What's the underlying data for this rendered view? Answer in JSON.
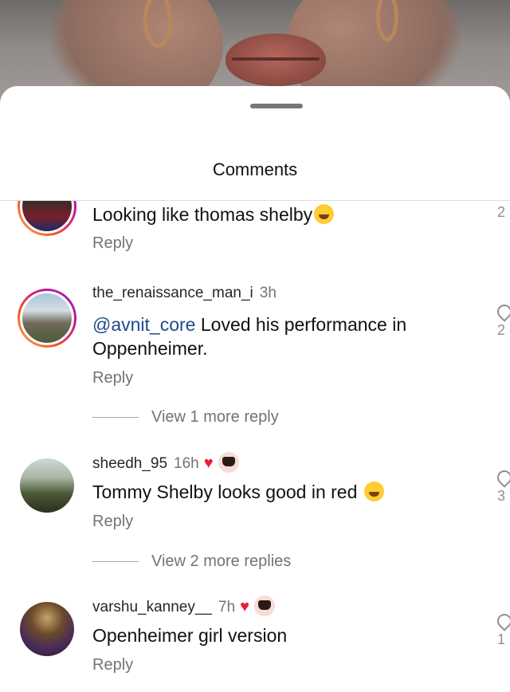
{
  "sheet": {
    "title": "Comments"
  },
  "comments": [
    {
      "text": "Looking like thomas shelby",
      "emoji": "tears-of-joy-emoji",
      "reply_label": "Reply",
      "like_count": "2"
    },
    {
      "username": "the_renaissance_man_i",
      "time": "3h",
      "mention": "@avnit_core",
      "text": " Loved his performance in Oppenheimer.",
      "reply_label": "Reply",
      "view_more": "View 1 more reply",
      "like_count": "2"
    },
    {
      "username": "sheedh_95",
      "time": "16h",
      "text": "Tommy Shelby looks good in red ",
      "emoji": "grinning-squinting-emoji",
      "reply_label": "Reply",
      "view_more": "View 2 more replies",
      "like_count": "3"
    },
    {
      "username": "varshu_kanney__",
      "time": "7h",
      "text": "Openheimer girl version",
      "reply_label": "Reply",
      "like_count": "1"
    }
  ],
  "icons": {
    "heart": "heart-icon",
    "like": "heart-outline-icon"
  },
  "colors": {
    "heart": "#ed1c3a",
    "mention": "#1f4a8a",
    "secondary_text": "#737373"
  }
}
